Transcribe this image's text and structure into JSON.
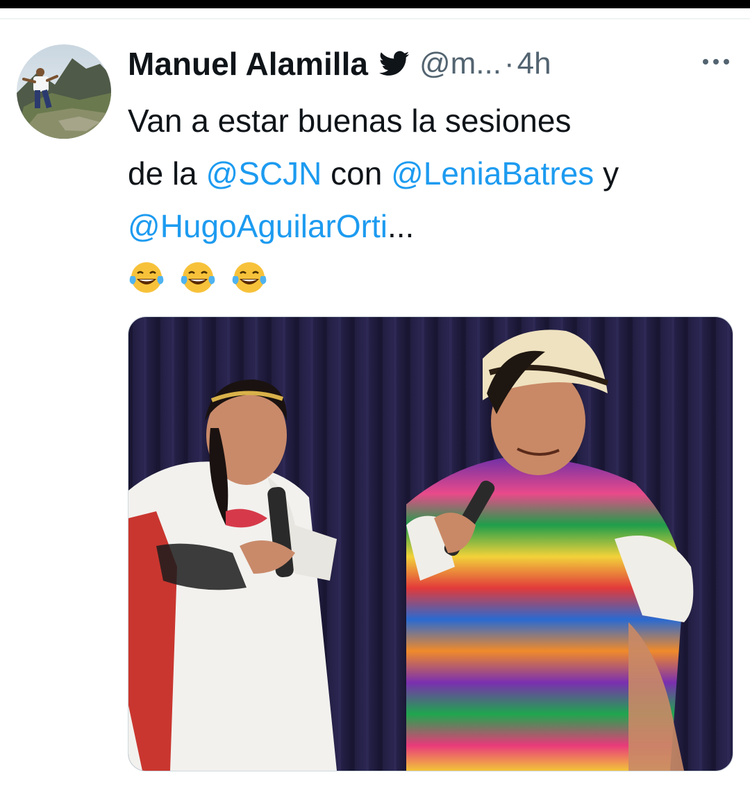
{
  "tweet": {
    "author": {
      "display_name": "Manuel Alamilla",
      "handle": "@m...",
      "verified_icon": "twitter-bird-icon"
    },
    "separator": "·",
    "time": "4h",
    "more_icon": "ellipsis-icon",
    "text": {
      "line1": "Van a estar buenas la sesiones",
      "part_de_la": "de la ",
      "mention_1": "@SCJN",
      "part_con": " con ",
      "mention_2": "@LeniaBatres",
      "part_y": " y",
      "mention_3": "@HugoAguilarOrti",
      "ellipsis": "...",
      "emojis": [
        "face-with-tears-of-joy",
        "face-with-tears-of-joy",
        "face-with-tears-of-joy"
      ]
    },
    "media": {
      "kind": "photo"
    }
  },
  "colors": {
    "text": "#0f1419",
    "secondary": "#536471",
    "link": "#1d9bf0",
    "background": "#ffffff"
  }
}
